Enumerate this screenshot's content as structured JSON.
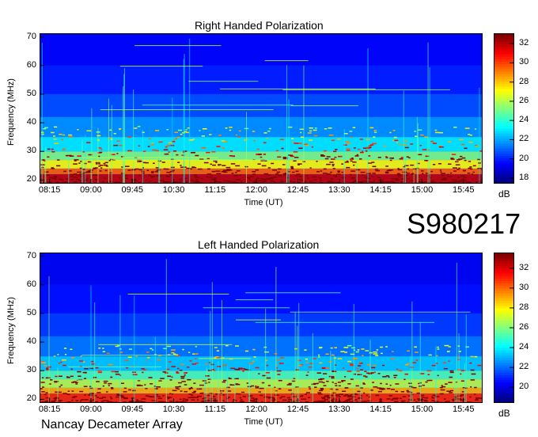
{
  "date_label": "S980217",
  "instrument": "Nancay Decameter Array",
  "chart_data": [
    {
      "type": "heatmap",
      "title": "Right Handed Polarization",
      "xlabel": "Time (UT)",
      "ylabel": "Frequency (MHz)",
      "x_ticks": [
        "08:15",
        "09:00",
        "09:45",
        "10:30",
        "11:15",
        "12:00",
        "12:45",
        "13:30",
        "14:15",
        "15:00",
        "15:45"
      ],
      "x_range": [
        "08:05",
        "16:05"
      ],
      "y_ticks": [
        20,
        30,
        40,
        50,
        60,
        70
      ],
      "y_range": [
        19,
        71
      ],
      "colorbar": {
        "label": "dB",
        "ticks": [
          18,
          20,
          22,
          24,
          26,
          28,
          30,
          32
        ],
        "range": [
          17.5,
          33
        ]
      }
    },
    {
      "type": "heatmap",
      "title": "Left Handed Polarization",
      "xlabel": "Time (UT)",
      "ylabel": "Frequency (MHz)",
      "x_ticks": [
        "08:15",
        "09:00",
        "09:45",
        "10:30",
        "11:15",
        "12:00",
        "12:45",
        "13:30",
        "14:15",
        "15:00",
        "15:45"
      ],
      "x_range": [
        "08:05",
        "16:05"
      ],
      "y_ticks": [
        20,
        30,
        40,
        50,
        60,
        70
      ],
      "y_range": [
        19,
        71
      ],
      "colorbar": {
        "label": "dB",
        "ticks": [
          20,
          22,
          24,
          26,
          28,
          30,
          32
        ],
        "range": [
          18.5,
          33.5
        ]
      }
    }
  ]
}
